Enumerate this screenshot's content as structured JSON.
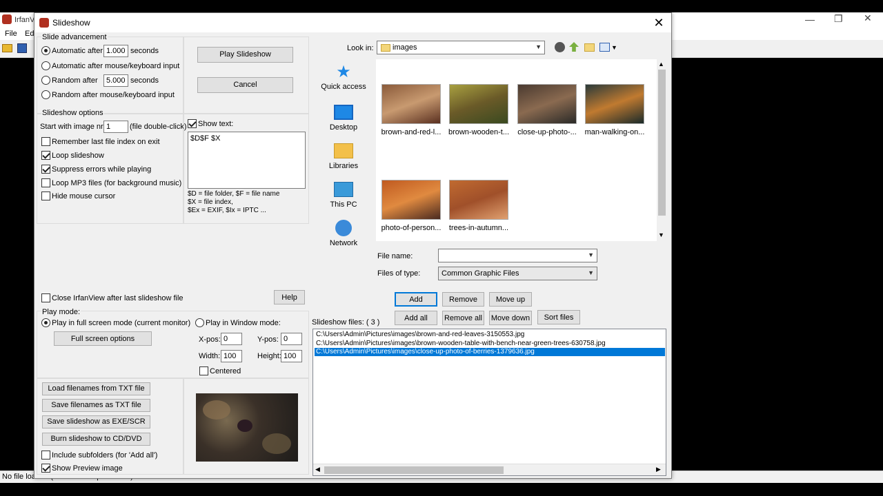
{
  "app": {
    "title": "IrfanView",
    "menu": [
      "File",
      "Edit"
    ],
    "status": "No file loaded (use File -> Open menu)"
  },
  "dialog": {
    "title": "Slideshow",
    "slide_adv": {
      "title": "Slide advancement",
      "auto_after": "Automatic after",
      "auto_value": "1.000",
      "seconds": "seconds",
      "auto_mouse": "Automatic after mouse/keyboard input",
      "random_after": "Random after",
      "random_value": "5.000",
      "random_mouse": "Random   after mouse/keyboard input"
    },
    "play_btn": "Play Slideshow",
    "cancel_btn": "Cancel",
    "options": {
      "title": "Slideshow options",
      "start_label": "Start with image nr.:",
      "start_value": "1",
      "start_hint": "(file double-click)",
      "remember": "Remember last file index on exit",
      "loop": "Loop slideshow",
      "suppress": "Suppress errors while playing",
      "loop_mp3": "Loop MP3 files (for background music)",
      "hide_cursor": "Hide mouse cursor",
      "show_text": "Show text:",
      "text_value": "$D$F $X",
      "help1": "$D = file folder, $F = file name",
      "help2": "$X = file index,",
      "help3": "$Ex = EXIF, $Ix = IPTC ..."
    },
    "close_after": "Close IrfanView after last slideshow file",
    "help_btn": "Help",
    "play_mode": {
      "title": "Play mode:",
      "fullscreen": "Play in full screen mode (current monitor)",
      "fullscreen_opts": "Full screen options",
      "window": "Play in Window mode:",
      "xpos_label": "X-pos:",
      "xpos": "0",
      "ypos_label": "Y-pos:",
      "ypos": "0",
      "width_label": "Width:",
      "width": "100",
      "height_label": "Height:",
      "height": "100",
      "centered": "Centered"
    },
    "bottom_btns": {
      "load": "Load filenames from TXT file",
      "save": "Save filenames as TXT file",
      "save_exe": "Save slideshow as  EXE/SCR",
      "burn": "Burn slideshow to CD/DVD"
    },
    "include_sub": "Include subfolders (for 'Add all')",
    "show_preview": "Show Preview image",
    "browser": {
      "look_in_label": "Look in:",
      "look_in": "images",
      "nav": [
        "Quick access",
        "Desktop",
        "Libraries",
        "This PC",
        "Network"
      ],
      "thumbs": [
        {
          "name": "brown-and-red-l...",
          "colors": [
            "#8a5a3a",
            "#c89a70",
            "#5a3020"
          ]
        },
        {
          "name": "brown-wooden-t...",
          "colors": [
            "#a8a040",
            "#6a5a28",
            "#3a4a20"
          ]
        },
        {
          "name": "close-up-photo-...",
          "colors": [
            "#4a3a30",
            "#8a6a50",
            "#2a2a28"
          ]
        },
        {
          "name": "man-walking-on...",
          "colors": [
            "#2a3a3a",
            "#c07a30",
            "#1a2a2a"
          ]
        },
        {
          "name": "photo-of-person...",
          "colors": [
            "#c05a20",
            "#e08a40",
            "#4a2a20"
          ]
        },
        {
          "name": "trees-in-autumn...",
          "colors": [
            "#c06a30",
            "#a0502a",
            "#e0a070"
          ]
        }
      ],
      "file_name_label": "File name:",
      "file_name": "",
      "type_label": "Files of type:",
      "type": "Common Graphic Files"
    },
    "actions": {
      "add": "Add",
      "remove": "Remove",
      "move_up": "Move up",
      "add_all": "Add all",
      "remove_all": "Remove all",
      "move_down": "Move down",
      "sort": "Sort files"
    },
    "slideshow_files_label": "Slideshow files:  ( 3 )",
    "files": [
      "C:\\Users\\Admin\\Pictures\\images\\brown-and-red-leaves-3150553.jpg",
      "C:\\Users\\Admin\\Pictures\\images\\brown-wooden-table-with-bench-near-green-trees-630758.jpg",
      "C:\\Users\\Admin\\Pictures\\images\\close-up-photo-of-berries-1379636.jpg"
    ]
  }
}
